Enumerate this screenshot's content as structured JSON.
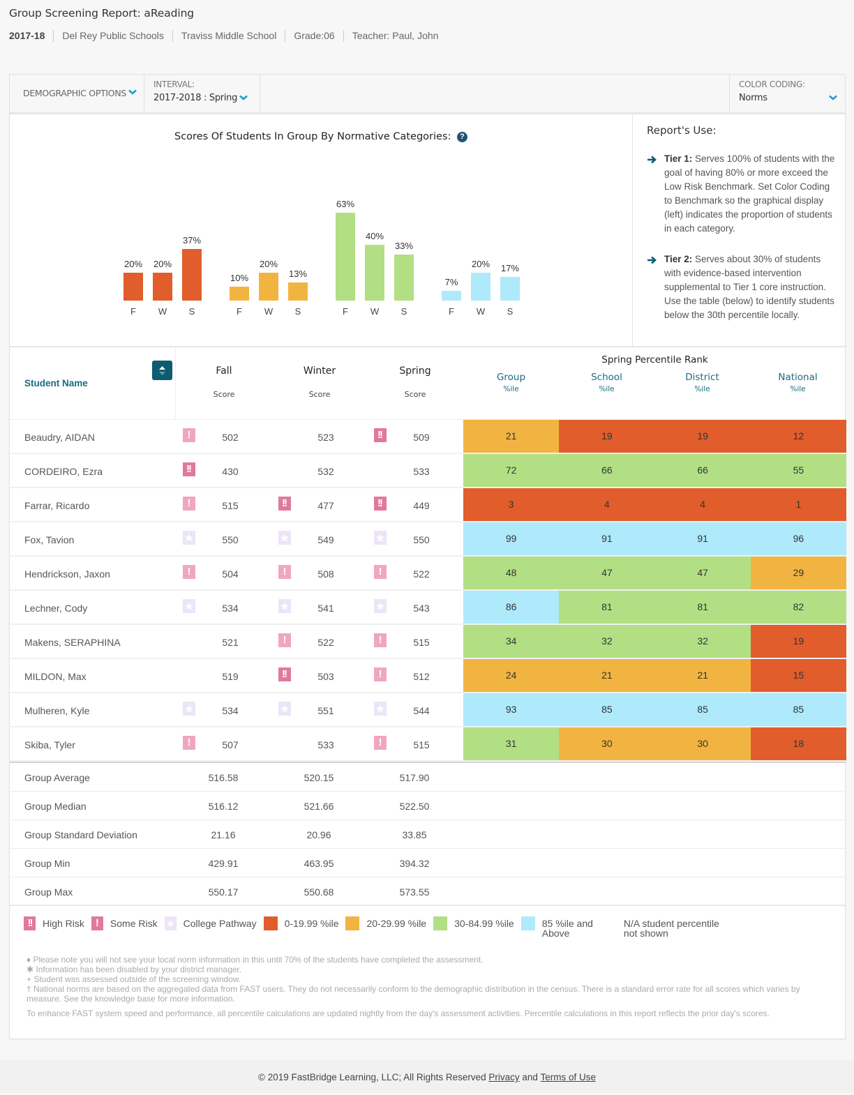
{
  "header": {
    "title": "Group Screening Report: aReading",
    "breadcrumb": [
      "2017-18",
      "Del Rey Public Schools",
      "Traviss Middle School",
      "Grade:06",
      "Teacher: Paul, John"
    ]
  },
  "filters": {
    "demographic_label": "DEMOGRAPHIC OPTIONS",
    "interval_label": "INTERVAL:",
    "interval_value": "2017-2018 : Spring",
    "color_coding_label": "COLOR CODING:",
    "color_coding_value": "Norms"
  },
  "colors": {
    "accent": "#1a6a82",
    "chevron": "#1b9fc9",
    "band_0_19": "#e15d2b",
    "band_20_29": "#f2b441",
    "band_30_84": "#b3df84",
    "band_85_up": "#aeeafc",
    "high_risk": "#e0799e",
    "some_risk": "#f0a6c0",
    "college_pathway": "#ece4f8"
  },
  "chart_data": {
    "type": "bar",
    "title": "Scores Of Students In Group By Normative Categories:",
    "categories": [
      "F",
      "W",
      "S"
    ],
    "category_names": [
      "Fall",
      "Winter",
      "Spring"
    ],
    "series": [
      {
        "name": "0-19.99 %ile",
        "color": "#e15d2b",
        "values": [
          20,
          20,
          37
        ]
      },
      {
        "name": "20-29.99 %ile",
        "color": "#f2b441",
        "values": [
          10,
          20,
          13
        ]
      },
      {
        "name": "30-84.99 %ile",
        "color": "#b3df84",
        "values": [
          63,
          40,
          33
        ]
      },
      {
        "name": "85 %ile and Above",
        "color": "#aeeafc",
        "values": [
          7,
          20,
          17
        ]
      }
    ],
    "value_suffix": "%",
    "ylim": [
      0,
      100
    ],
    "grid": false,
    "xlabel": "",
    "ylabel": ""
  },
  "report_use": {
    "title": "Report's Use:",
    "tiers": [
      {
        "label": "Tier 1:",
        "text": " Serves 100% of students with the goal of having 80% or more exceed the Low Risk Benchmark. Set Color Coding to Benchmark so the graphical display (left) indicates the proportion of students in each category."
      },
      {
        "label": "Tier 2:",
        "text": " Serves about 30% of students with evidence-based intervention supplemental to Tier 1 core instruction. Use the table (below) to identify students below the 30th percentile locally."
      }
    ]
  },
  "table": {
    "name_header": "Student Name",
    "seasons": [
      "Fall",
      "Winter",
      "Spring"
    ],
    "score_sub": "Score",
    "percentile_header": "Spring Percentile Rank",
    "percentile_cols": [
      "Group",
      "School",
      "District",
      "National"
    ],
    "percentile_sub": "%ile",
    "rows": [
      {
        "name": "Beaudry, AIDAN",
        "scores": [
          "502",
          "523",
          "509"
        ],
        "flags": [
          "some",
          "",
          "high"
        ],
        "pct": [
          "21",
          "19",
          "19",
          "12"
        ],
        "bands": [
          "b20",
          "b0",
          "b0",
          "b0"
        ]
      },
      {
        "name": "CORDEIRO, Ezra",
        "scores": [
          "430",
          "532",
          "533"
        ],
        "flags": [
          "high",
          "",
          ""
        ],
        "pct": [
          "72",
          "66",
          "66",
          "55"
        ],
        "bands": [
          "b30",
          "b30",
          "b30",
          "b30"
        ]
      },
      {
        "name": "Farrar, Ricardo",
        "scores": [
          "515",
          "477",
          "449"
        ],
        "flags": [
          "some",
          "high",
          "high"
        ],
        "pct": [
          "3",
          "4",
          "4",
          "1"
        ],
        "bands": [
          "b0",
          "b0",
          "b0",
          "b0"
        ]
      },
      {
        "name": "Fox, Tavion",
        "scores": [
          "550",
          "549",
          "550"
        ],
        "flags": [
          "college",
          "college",
          "college"
        ],
        "pct": [
          "99",
          "91",
          "91",
          "96"
        ],
        "bands": [
          "b85",
          "b85",
          "b85",
          "b85"
        ]
      },
      {
        "name": "Hendrickson, Jaxon",
        "scores": [
          "504",
          "508",
          "522"
        ],
        "flags": [
          "some",
          "some",
          "some"
        ],
        "pct": [
          "48",
          "47",
          "47",
          "29"
        ],
        "bands": [
          "b30",
          "b30",
          "b30",
          "b20"
        ]
      },
      {
        "name": "Lechner, Cody",
        "scores": [
          "534",
          "541",
          "543"
        ],
        "flags": [
          "college",
          "college",
          "college"
        ],
        "pct": [
          "86",
          "81",
          "81",
          "82"
        ],
        "bands": [
          "b85",
          "b30",
          "b30",
          "b30"
        ]
      },
      {
        "name": "Makens, SERAPHINA",
        "scores": [
          "521",
          "522",
          "515"
        ],
        "flags": [
          "",
          "some",
          "some"
        ],
        "pct": [
          "34",
          "32",
          "32",
          "19"
        ],
        "bands": [
          "b30",
          "b30",
          "b30",
          "b0"
        ]
      },
      {
        "name": "MILDON, Max",
        "scores": [
          "519",
          "503",
          "512"
        ],
        "flags": [
          "",
          "high",
          "some"
        ],
        "pct": [
          "24",
          "21",
          "21",
          "15"
        ],
        "bands": [
          "b20",
          "b20",
          "b20",
          "b0"
        ]
      },
      {
        "name": "Mulheren, Kyle",
        "scores": [
          "534",
          "551",
          "544"
        ],
        "flags": [
          "college",
          "college",
          "college"
        ],
        "pct": [
          "93",
          "85",
          "85",
          "85"
        ],
        "bands": [
          "b85",
          "b85",
          "b85",
          "b85"
        ]
      },
      {
        "name": "Skiba, Tyler",
        "scores": [
          "507",
          "533",
          "515"
        ],
        "flags": [
          "some",
          "",
          "some"
        ],
        "pct": [
          "31",
          "30",
          "30",
          "18"
        ],
        "bands": [
          "b30",
          "b20",
          "b20",
          "b0"
        ]
      }
    ],
    "stats": [
      {
        "label": "Group Average",
        "values": [
          "516.58",
          "520.15",
          "517.90"
        ]
      },
      {
        "label": "Group Median",
        "values": [
          "516.12",
          "521.66",
          "522.50"
        ]
      },
      {
        "label": "Group Standard Deviation",
        "values": [
          "21.16",
          "20.96",
          "33.85"
        ]
      },
      {
        "label": "Group Min",
        "values": [
          "429.91",
          "463.95",
          "394.32"
        ]
      },
      {
        "label": "Group Max",
        "values": [
          "550.17",
          "550.68",
          "573.55"
        ]
      }
    ]
  },
  "legend": {
    "high_risk": "High Risk",
    "some_risk": "Some Risk",
    "college_pathway": "College Pathway",
    "band_0_19": "0-19.99 %ile",
    "band_20_29": "20-29.99 %ile",
    "band_30_84": "30-84.99 %ile",
    "band_85_line1": "85 %ile and",
    "band_85_line2": "Above",
    "na_line1": "N/A student percentile",
    "na_line2": "not shown"
  },
  "notes": {
    "n1": "♦ Please note you will not see your local norm information in this until 70% of the students have completed the assessment.",
    "n2": "✱ Information has been disabled by your district manager.",
    "n3": "+ Student was assessed outside of the screening window.",
    "n4": "† National norms are based on the aggregated data from FAST users. They do not necessarily conform to the demographic distribution in the census. There is a standard error rate for all scores which varies by measure. See the knowledge base for more information.",
    "n5": "To enhance FAST system speed and performance, all percentile calculations are updated nightly from the day's assessment activities. Percentile calculations in this report reflects the prior day's scores."
  },
  "footer": {
    "copyright": "© 2019 FastBridge Learning, LLC; All Rights Reserved ",
    "privacy": "Privacy",
    "and": " and ",
    "terms": "Terms of Use"
  }
}
